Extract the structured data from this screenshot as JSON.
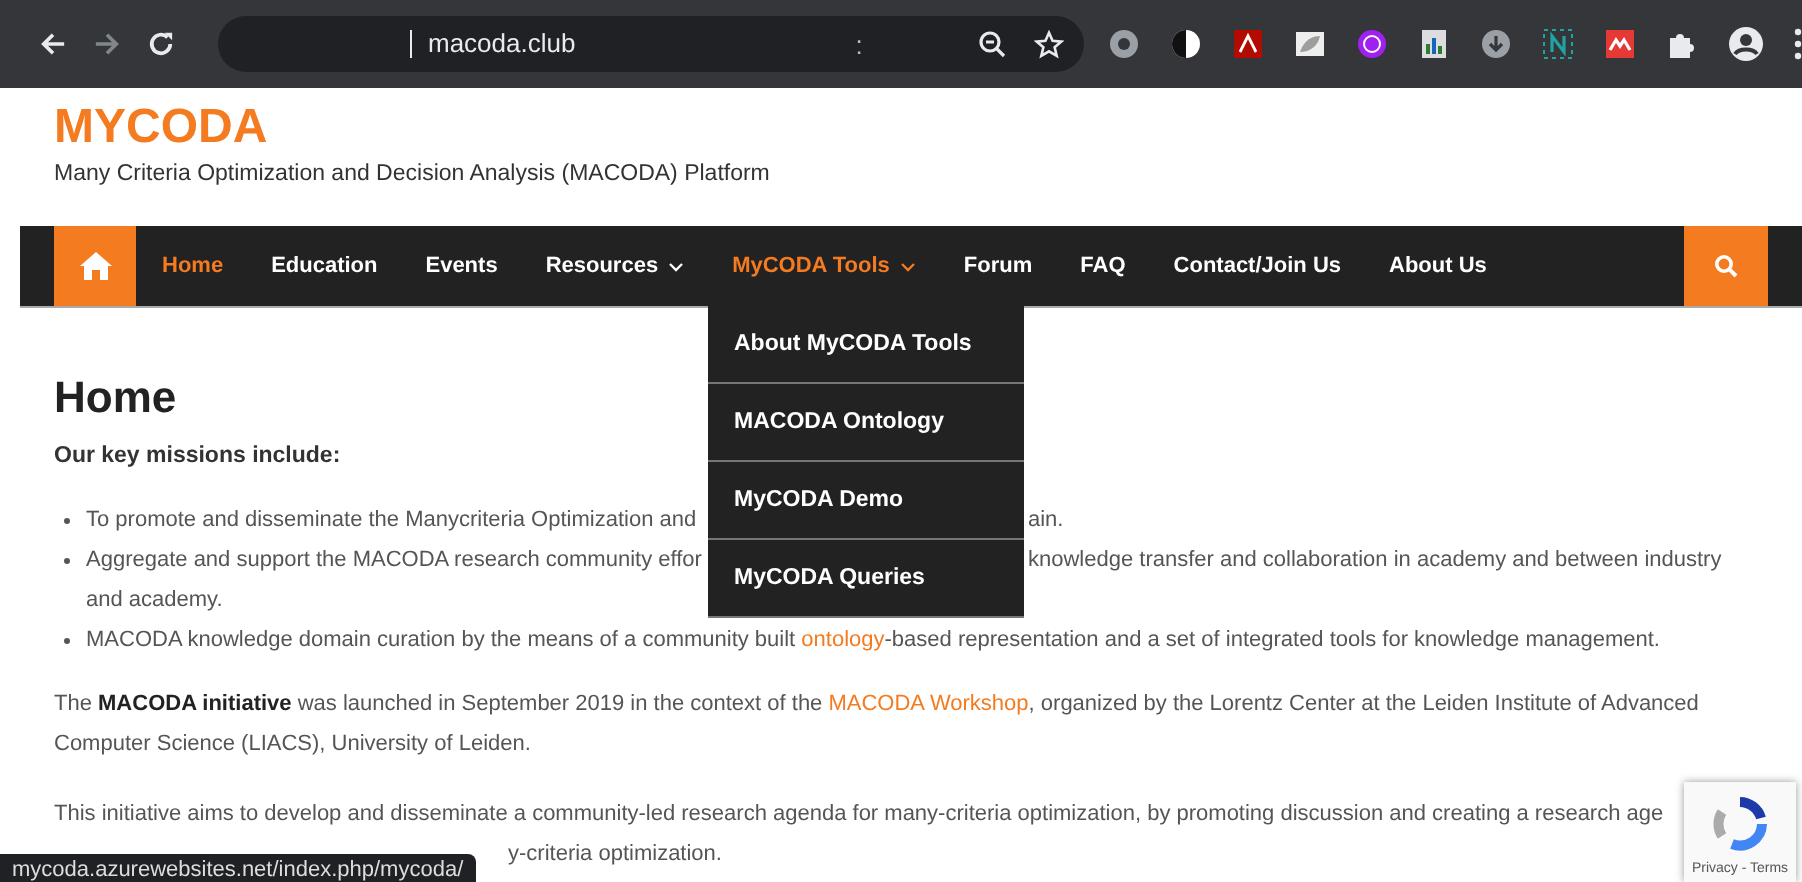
{
  "browser": {
    "address": "macoda.club",
    "address_mark": ":"
  },
  "site": {
    "logo": "MYCODA",
    "tagline": "Many Criteria Optimization and Decision Analysis (MACODA) Platform"
  },
  "nav": {
    "items": [
      {
        "kind": "link",
        "label": "Home",
        "selected": true
      },
      {
        "kind": "link",
        "label": "Education",
        "selected": false
      },
      {
        "kind": "link",
        "label": "Events",
        "selected": false
      },
      {
        "kind": "dropdown",
        "label": "Resources",
        "selected": false
      },
      {
        "kind": "dropdown",
        "label": "MyCODA Tools",
        "selected": true,
        "expanded": true,
        "menu": [
          "About MyCODA Tools",
          "MACODA Ontology",
          "MyCODA Demo",
          "MyCODA Queries"
        ]
      },
      {
        "kind": "link",
        "label": "Forum",
        "selected": false
      },
      {
        "kind": "link",
        "label": "FAQ",
        "selected": false
      },
      {
        "kind": "link",
        "label": "Contact/Join Us",
        "selected": false
      },
      {
        "kind": "link",
        "label": "About Us",
        "selected": false
      }
    ]
  },
  "content": {
    "title": "Home",
    "intro": "Our key missions include:",
    "bullets": [
      {
        "lines": [
          {
            "left": "To promote and disseminate the Manycriteria Optimization and",
            "right": "ain."
          }
        ]
      },
      {
        "lines": [
          {
            "left": "Aggregate and support the MACODA research community effor",
            "right": "knowledge transfer and collaboration in academy and between industry"
          },
          {
            "left": "and academy."
          }
        ]
      },
      {
        "lines": [
          {
            "parts": [
              {
                "kind": "text",
                "text": "MACODA knowledge domain curation by the means of a community built "
              },
              {
                "kind": "link",
                "text": "ontology"
              },
              {
                "kind": "text",
                "text": "-based representation and a set of integrated tools for knowledge management."
              }
            ]
          }
        ]
      }
    ],
    "paragraph": [
      {
        "kind": "text",
        "text": "The **MACODA initiative** was launched in September 2019 in the context of the "
      },
      {
        "kind": "link",
        "text": "MACODA Workshop"
      },
      {
        "kind": "text",
        "text": ", organized by the Lorentz Center at the Leiden Institute of Advanced Computer Science (LIACS), University of Leiden."
      }
    ],
    "closing": [
      "This initiative aims to develop and disseminate a community-led research agenda for many-criteria optimization, by promoting discussion and creating a research age",
      "y-criteria optimization."
    ]
  },
  "status_url": "mycoda.azurewebsites.net/index.php/mycoda/",
  "recaptcha": {
    "links": "Privacy - Terms"
  }
}
